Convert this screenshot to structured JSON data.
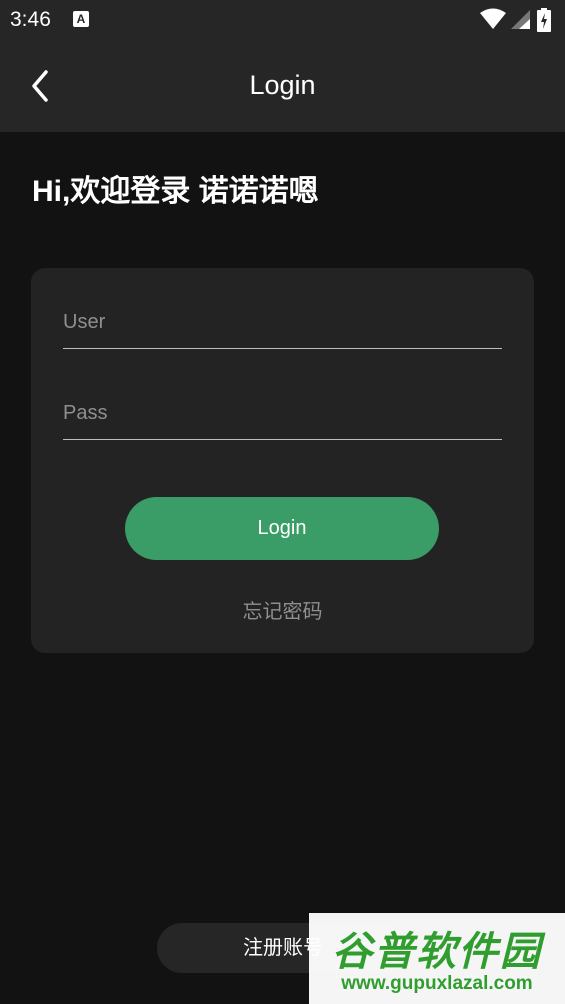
{
  "status_bar": {
    "time": "3:46",
    "icons": [
      "a-notification-icon",
      "wifi-icon",
      "signal-icon",
      "battery-icon"
    ]
  },
  "app_bar": {
    "title": "Login",
    "back_icon": "chevron-left-icon"
  },
  "greeting": "Hi,欢迎登录 诺诺诺嗯",
  "form": {
    "user_placeholder": "User",
    "pass_placeholder": "Pass",
    "login_label": "Login",
    "forgot_label": "忘记密码"
  },
  "register_label": "注册账号",
  "watermark": {
    "logo": "谷普软件园",
    "url": "www.gupuxlazal.com"
  },
  "colors": {
    "background": "#121212",
    "bar": "#262626",
    "card": "#232323",
    "accent": "#3a9d67"
  }
}
